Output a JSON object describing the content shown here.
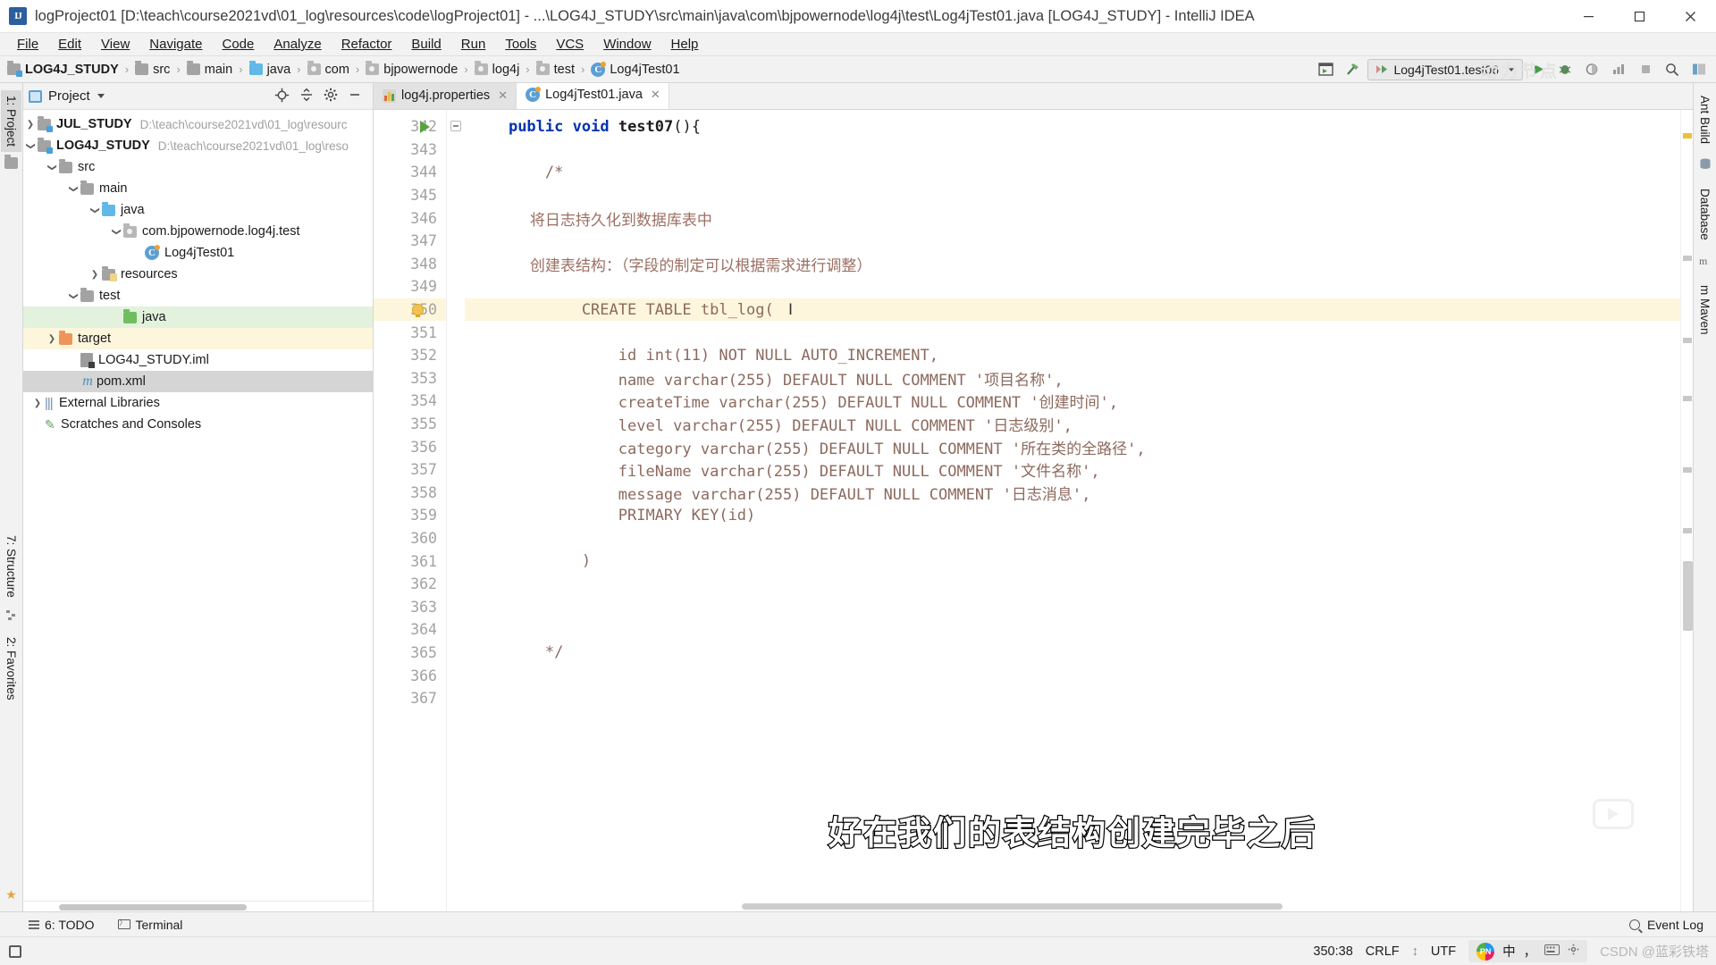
{
  "window": {
    "title": "logProject01 [D:\\teach\\course2021vd\\01_log\\resources\\code\\logProject01] - ...\\LOG4J_STUDY\\src\\main\\java\\com\\bjpowernode\\log4j\\test\\Log4jTest01.java [LOG4J_STUDY] - IntelliJ IDEA",
    "app_icon_label": "IJ",
    "minimize": "—",
    "maximize": "❐",
    "close": "✕"
  },
  "menubar": {
    "items": [
      {
        "label": "File"
      },
      {
        "label": "Edit"
      },
      {
        "label": "View"
      },
      {
        "label": "Navigate"
      },
      {
        "label": "Code"
      },
      {
        "label": "Analyze"
      },
      {
        "label": "Refactor"
      },
      {
        "label": "Build"
      },
      {
        "label": "Run"
      },
      {
        "label": "Tools"
      },
      {
        "label": "VCS"
      },
      {
        "label": "Window"
      },
      {
        "label": "Help"
      }
    ]
  },
  "navbar": {
    "crumbs": [
      {
        "label": "LOG4J_STUDY",
        "icon": "module-folder-icon",
        "bold": true
      },
      {
        "label": "src",
        "icon": "folder-icon",
        "bold": false
      },
      {
        "label": "main",
        "icon": "folder-icon",
        "bold": false
      },
      {
        "label": "java",
        "icon": "source-folder-icon",
        "bold": false
      },
      {
        "label": "com",
        "icon": "package-icon",
        "bold": false
      },
      {
        "label": "bjpowernode",
        "icon": "package-icon",
        "bold": false
      },
      {
        "label": "log4j",
        "icon": "package-icon",
        "bold": false
      },
      {
        "label": "test",
        "icon": "package-icon",
        "bold": false
      },
      {
        "label": "Log4jTest01",
        "icon": "java-class-icon",
        "bold": false
      }
    ],
    "separator": "›",
    "run_config": "Log4jTest01.test06",
    "watermark": "动力节点",
    "buttons": [
      {
        "name": "select-opened-file-icon"
      },
      {
        "name": "build-hammer-icon"
      },
      {
        "name": "run-icon"
      },
      {
        "name": "debug-icon"
      },
      {
        "name": "run-coverage-icon"
      },
      {
        "name": "profiler-icon"
      },
      {
        "name": "stop-icon"
      },
      {
        "name": "search-everywhere-icon"
      },
      {
        "name": "layout-icon"
      }
    ]
  },
  "left_strip": {
    "project_tab": "1: Project",
    "structure_tab": "7: Structure",
    "favorites_tab": "2: Favorites"
  },
  "right_strip": {
    "ant_build_tab": "Ant Build",
    "database_tab": "Database",
    "maven_tab": "m Maven"
  },
  "project_panel": {
    "title": "Project",
    "tools": [
      {
        "name": "locate-target-icon",
        "glyph": "⊕"
      },
      {
        "name": "collapse-all-icon",
        "glyph": "≡"
      },
      {
        "name": "settings-gear-icon",
        "glyph": "⚙"
      },
      {
        "name": "hide-panel-icon",
        "glyph": "—"
      }
    ],
    "tree": [
      {
        "label": "JUL_STUDY",
        "path": "D:\\teach\\course2021vd\\01_log\\resourc",
        "indent": 0,
        "arrow": "right",
        "icon": "module-folder-icon",
        "bold": true,
        "state": ""
      },
      {
        "label": "LOG4J_STUDY",
        "path": "D:\\teach\\course2021vd\\01_log\\reso",
        "indent": 0,
        "arrow": "down",
        "icon": "module-folder-icon",
        "bold": true,
        "state": ""
      },
      {
        "label": "src",
        "path": "",
        "indent": 1,
        "arrow": "down",
        "icon": "folder-icon",
        "bold": false,
        "state": ""
      },
      {
        "label": "main",
        "path": "",
        "indent": 2,
        "arrow": "down",
        "icon": "folder-icon",
        "bold": false,
        "state": ""
      },
      {
        "label": "java",
        "path": "",
        "indent": 3,
        "arrow": "down",
        "icon": "source-folder-icon",
        "bold": false,
        "state": ""
      },
      {
        "label": "com.bjpowernode.log4j.test",
        "path": "",
        "indent": 4,
        "arrow": "down",
        "icon": "package-icon",
        "bold": false,
        "state": ""
      },
      {
        "label": "Log4jTest01",
        "path": "",
        "indent": 5,
        "arrow": "none",
        "icon": "java-class-icon",
        "bold": false,
        "state": ""
      },
      {
        "label": "resources",
        "path": "",
        "indent": 3,
        "arrow": "right",
        "icon": "resources-folder-icon",
        "bold": false,
        "state": ""
      },
      {
        "label": "test",
        "path": "",
        "indent": 2,
        "arrow": "down",
        "icon": "folder-icon",
        "bold": false,
        "state": ""
      },
      {
        "label": "java",
        "path": "",
        "indent": 3,
        "arrow": "none",
        "icon": "test-source-folder-icon",
        "bold": false,
        "state": "green"
      },
      {
        "label": "target",
        "path": "",
        "indent": 1,
        "arrow": "right",
        "icon": "excluded-folder-icon",
        "bold": false,
        "state": "yellow"
      },
      {
        "label": "LOG4J_STUDY.iml",
        "path": "",
        "indent": 1,
        "arrow": "none",
        "icon": "iml-file-icon",
        "bold": false,
        "state": ""
      },
      {
        "label": "pom.xml",
        "path": "",
        "indent": 1,
        "arrow": "none",
        "icon": "maven-pom-icon",
        "bold": false,
        "state": "gray"
      },
      {
        "label": "External Libraries",
        "path": "",
        "indent": 0,
        "arrow": "right",
        "icon": "libraries-icon",
        "bold": false,
        "state": ""
      },
      {
        "label": "Scratches and Consoles",
        "path": "",
        "indent": 0,
        "arrow": "none",
        "icon": "scratches-icon",
        "bold": false,
        "state": ""
      }
    ]
  },
  "editor": {
    "tabs": [
      {
        "label": "log4j.properties",
        "icon": "properties-file-icon",
        "active": false
      },
      {
        "label": "Log4jTest01.java",
        "icon": "java-class-icon",
        "active": true
      }
    ],
    "close_glyph": "✕",
    "first_line_number": 342,
    "highlight_line": 350,
    "lines": [
      {
        "n": 342,
        "segs": [
          {
            "t": "    ",
            "c": "pl"
          },
          {
            "t": "public",
            "c": "kw"
          },
          {
            "t": " ",
            "c": "pl"
          },
          {
            "t": "void",
            "c": "kw"
          },
          {
            "t": " ",
            "c": "pl"
          },
          {
            "t": "test07",
            "c": "mth"
          },
          {
            "t": "(){",
            "c": "pl"
          }
        ]
      },
      {
        "n": 343,
        "segs": []
      },
      {
        "n": 344,
        "segs": [
          {
            "t": "        /*",
            "c": "cmt"
          }
        ]
      },
      {
        "n": 345,
        "segs": []
      },
      {
        "n": 346,
        "segs": [
          {
            "t": "            将日志持久化到数据库表中",
            "c": "cmt-cn"
          }
        ]
      },
      {
        "n": 347,
        "segs": []
      },
      {
        "n": 348,
        "segs": [
          {
            "t": "            创建表结构：（字段的制定可以根据需求进行调整）",
            "c": "cmt-cn"
          }
        ]
      },
      {
        "n": 349,
        "segs": []
      },
      {
        "n": 350,
        "segs": [
          {
            "t": "            CREATE TABLE tbl_log(",
            "c": "cmt"
          }
        ]
      },
      {
        "n": 351,
        "segs": []
      },
      {
        "n": 352,
        "segs": [
          {
            "t": "                id int(11) NOT NULL AUTO_INCREMENT,",
            "c": "cmt"
          }
        ]
      },
      {
        "n": 353,
        "segs": [
          {
            "t": "                name varchar(255) DEFAULT NULL COMMENT '项目名称',",
            "c": "cmt"
          }
        ]
      },
      {
        "n": 354,
        "segs": [
          {
            "t": "                createTime varchar(255) DEFAULT NULL COMMENT '创建时间',",
            "c": "cmt"
          }
        ]
      },
      {
        "n": 355,
        "segs": [
          {
            "t": "                level varchar(255) DEFAULT NULL COMMENT '日志级别',",
            "c": "cmt"
          }
        ]
      },
      {
        "n": 356,
        "segs": [
          {
            "t": "                category varchar(255) DEFAULT NULL COMMENT '所在类的全路径',",
            "c": "cmt"
          }
        ]
      },
      {
        "n": 357,
        "segs": [
          {
            "t": "                fileName varchar(255) DEFAULT NULL COMMENT '文件名称',",
            "c": "cmt"
          }
        ]
      },
      {
        "n": 358,
        "segs": [
          {
            "t": "                message varchar(255) DEFAULT NULL COMMENT '日志消息',",
            "c": "cmt"
          }
        ]
      },
      {
        "n": 359,
        "segs": [
          {
            "t": "                PRIMARY KEY(id)",
            "c": "cmt"
          }
        ]
      },
      {
        "n": 360,
        "segs": []
      },
      {
        "n": 361,
        "segs": [
          {
            "t": "            )",
            "c": "cmt"
          }
        ]
      },
      {
        "n": 362,
        "segs": []
      },
      {
        "n": 363,
        "segs": []
      },
      {
        "n": 364,
        "segs": []
      },
      {
        "n": 365,
        "segs": [
          {
            "t": "        */",
            "c": "cmt"
          }
        ]
      },
      {
        "n": 366,
        "segs": []
      },
      {
        "n": 367,
        "segs": []
      }
    ]
  },
  "overlay": {
    "subtitle": "好在我们的表结构创建完毕之后"
  },
  "tool_window_bar": {
    "todo": "6: TODO",
    "todo_prefix": "6",
    "terminal": "Terminal",
    "event_log": "Event Log"
  },
  "statusbar": {
    "caret_position": "350:38",
    "line_separator": "CRLF",
    "encoding": "UTF",
    "ime_lang": "中",
    "ime_punct": "，",
    "ime_logo": "PN",
    "csdn": "CSDN @蓝彩铁塔",
    "separator_glyph": "↕"
  },
  "colors": {
    "accent_blue": "#4a90c4",
    "comment_brown": "#8c6a5e",
    "keyword_blue": "#0033b3",
    "highlight_yellow": "#fdf6dc",
    "tree_green": "#e3f2dc",
    "tree_yellow": "#fdf6dc"
  }
}
